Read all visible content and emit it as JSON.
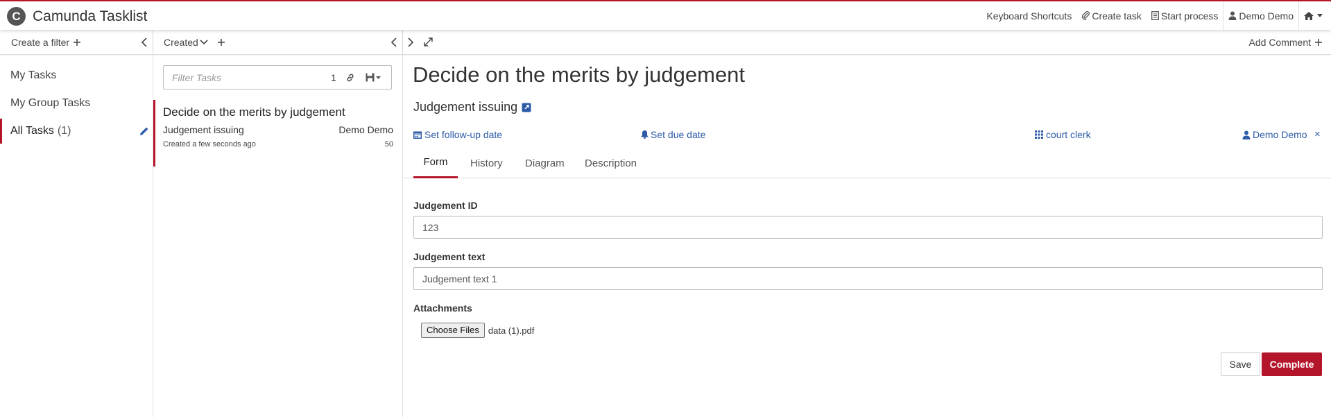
{
  "header": {
    "app_title": "Camunda Tasklist",
    "logo_letter": "C",
    "keyboard_shortcuts": "Keyboard Shortcuts",
    "create_task": "Create task",
    "start_process": "Start process",
    "user": "Demo Demo"
  },
  "filters": {
    "create_label": "Create a filter",
    "items": [
      {
        "label": "My Tasks"
      },
      {
        "label": "My Group Tasks"
      },
      {
        "label": "All Tasks",
        "count": "(1)"
      }
    ]
  },
  "list": {
    "sort_label": "Created",
    "search_placeholder": "Filter Tasks",
    "search_count": "1",
    "tasks": [
      {
        "name": "Decide on the merits by judgement",
        "process": "Judgement issuing",
        "assignee": "Demo Demo",
        "created": "Created a few seconds ago",
        "priority": "50"
      }
    ]
  },
  "task": {
    "add_comment": "Add Comment",
    "title": "Decide on the merits by judgement",
    "process_name": "Judgement issuing",
    "set_follow_up": "Set follow-up date",
    "set_due": "Set due date",
    "group": "court clerk",
    "assignee": "Demo Demo",
    "remove_assignee": "×",
    "tabs": [
      {
        "label": "Form"
      },
      {
        "label": "History"
      },
      {
        "label": "Diagram"
      },
      {
        "label": "Description"
      }
    ],
    "form": {
      "judgement_id_label": "Judgement ID",
      "judgement_id_value": "123",
      "judgement_text_label": "Judgement text",
      "judgement_text_value": "Judgement text 1",
      "attachments_label": "Attachments",
      "choose_files": "Choose Files",
      "file_name": "data (1).pdf",
      "save": "Save",
      "complete": "Complete"
    }
  },
  "colors": {
    "accent": "#b5152b",
    "link": "#2d5aa7"
  }
}
